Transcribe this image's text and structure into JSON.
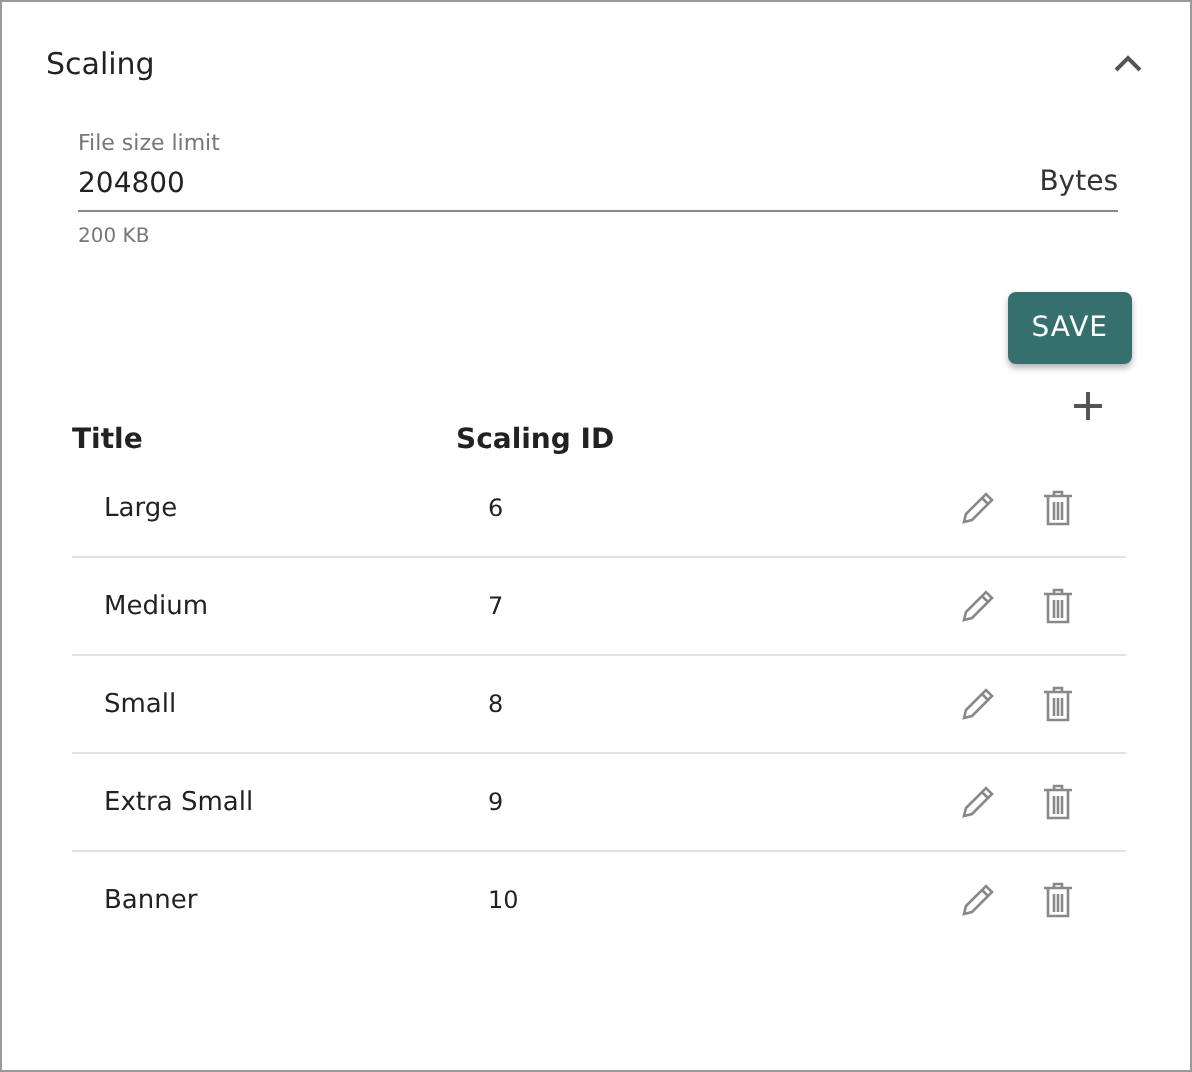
{
  "panel": {
    "title": "Scaling",
    "expanded": true
  },
  "field": {
    "label": "File size limit",
    "value": "204800",
    "suffix": "Bytes",
    "hint": "200 KB"
  },
  "save_button": "SAVE",
  "table": {
    "columns": [
      "Title",
      "Scaling ID"
    ],
    "rows": [
      {
        "title": "Large",
        "scaling_id": "6"
      },
      {
        "title": "Medium",
        "scaling_id": "7"
      },
      {
        "title": "Small",
        "scaling_id": "8"
      },
      {
        "title": "Extra Small",
        "scaling_id": "9"
      },
      {
        "title": "Banner",
        "scaling_id": "10"
      }
    ]
  }
}
